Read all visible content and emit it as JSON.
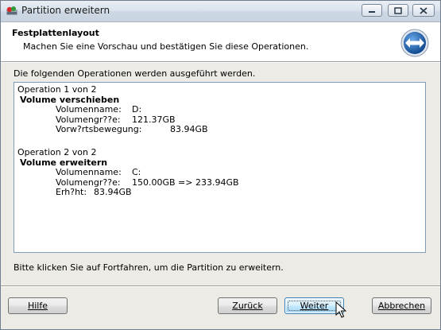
{
  "window": {
    "title": "Partition erweitern",
    "controls": {
      "minimize_icon": "minimize-icon",
      "maximize_icon": "maximize-icon",
      "close_icon": "close-icon"
    }
  },
  "header": {
    "title": "Festplattenlayout",
    "subtitle": "Machen Sie eine Vorschau und bestätigen Sie diese Operationen."
  },
  "intro_text": "Die folgenden Operationen werden ausgeführt werden.",
  "operations": [
    {
      "title": "Operation 1 von 2",
      "action": "Volume verschieben",
      "fields": [
        {
          "label": "Volumenname:",
          "value": "D:"
        },
        {
          "label": "Volumengr??e:",
          "value": "121.37GB"
        },
        {
          "label": "Vorw?rtsbewegung:",
          "value": "83.94GB"
        }
      ]
    },
    {
      "title": "Operation 2 von 2",
      "action": "Volume erweitern",
      "fields": [
        {
          "label": "Volumenname:",
          "value": "C:"
        },
        {
          "label": "Volumengr??e:",
          "value": "150.00GB => 233.94GB"
        },
        {
          "label": "Erh?ht:",
          "value": "83.94GB"
        }
      ]
    }
  ],
  "bottom_hint": "Bitte klicken Sie auf Fortfahren, um die Partition zu erweitern.",
  "buttons": {
    "help": "Hilfe",
    "back": "Zurück",
    "next": "Weiter",
    "cancel": "Abbrechen"
  },
  "colors": {
    "accent": "#1a63b8",
    "listbox_border": "#7f9db9"
  }
}
